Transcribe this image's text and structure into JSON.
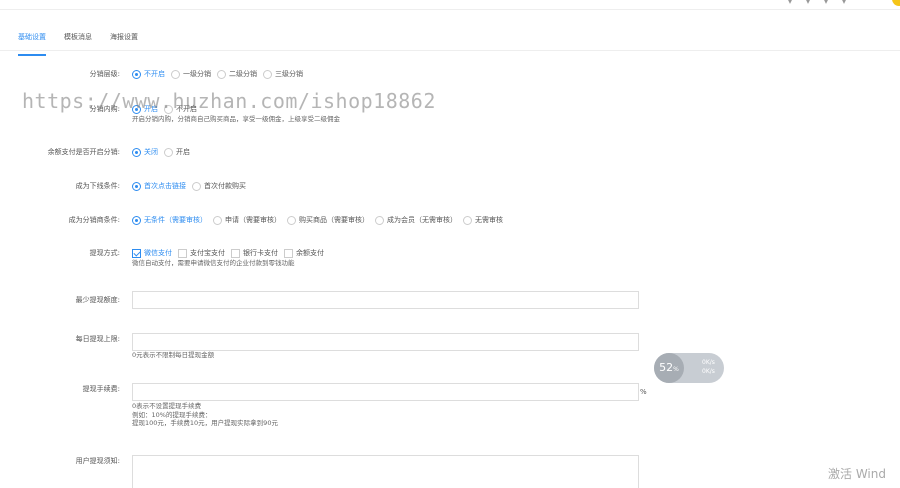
{
  "tabs": [
    "基础设置",
    "模板消息",
    "海报设置"
  ],
  "watermark": "https://www.huzhan.com/ishop18862",
  "form": {
    "levels": {
      "label": "分销层级:",
      "options": [
        "不开启",
        "一级分销",
        "二级分销",
        "三级分销"
      ],
      "selected": 0
    },
    "inner_buy": {
      "label": "分销内购:",
      "options": [
        "开启",
        "不开启"
      ],
      "selected": 0,
      "help": "开启分销内购，分销商自己购买商品，享受一级佣金，上级享受二级佣金"
    },
    "balance_pay": {
      "label": "余额支付是否开启分销:",
      "options": [
        "关闭",
        "开启"
      ],
      "selected": 0
    },
    "downline": {
      "label": "成为下线条件:",
      "options": [
        "首次点击链接",
        "首次付款购买"
      ],
      "selected": 0
    },
    "distributor": {
      "label": "成为分销商条件:",
      "options": [
        "无条件（需要审核）",
        "申请（需要审核）",
        "购买商品（需要审核）",
        "成为会员（无需审核）",
        "无需审核"
      ],
      "selected": 0
    },
    "withdraw_methods": {
      "label": "提现方式:",
      "options": [
        "微信支付",
        "支付宝支付",
        "银行卡支付",
        "余额支付"
      ],
      "checked": [
        true,
        false,
        false,
        false
      ],
      "help": "微信自动支付，需要申请微信支付的企业付款到零钱功能"
    },
    "min_withdraw": {
      "label": "最少提现额度:",
      "value": ""
    },
    "daily_limit": {
      "label": "每日提现上限:",
      "value": "",
      "help": "0元表示不限制每日提现金额"
    },
    "fee": {
      "label": "提现手续费:",
      "value": "",
      "suffix": "%",
      "help": [
        "0表示不设置提现手续费",
        "例如：10%的提现手续费：",
        "提现100元，手续费10元，用户提现实际拿到90元"
      ]
    },
    "notice": {
      "label": "用户提现须知:",
      "value": ""
    }
  },
  "speed_widget": {
    "percent": "52",
    "unit": "%",
    "up": "0K/s",
    "down": "0K/s"
  },
  "activate_text": "激活 Wind"
}
